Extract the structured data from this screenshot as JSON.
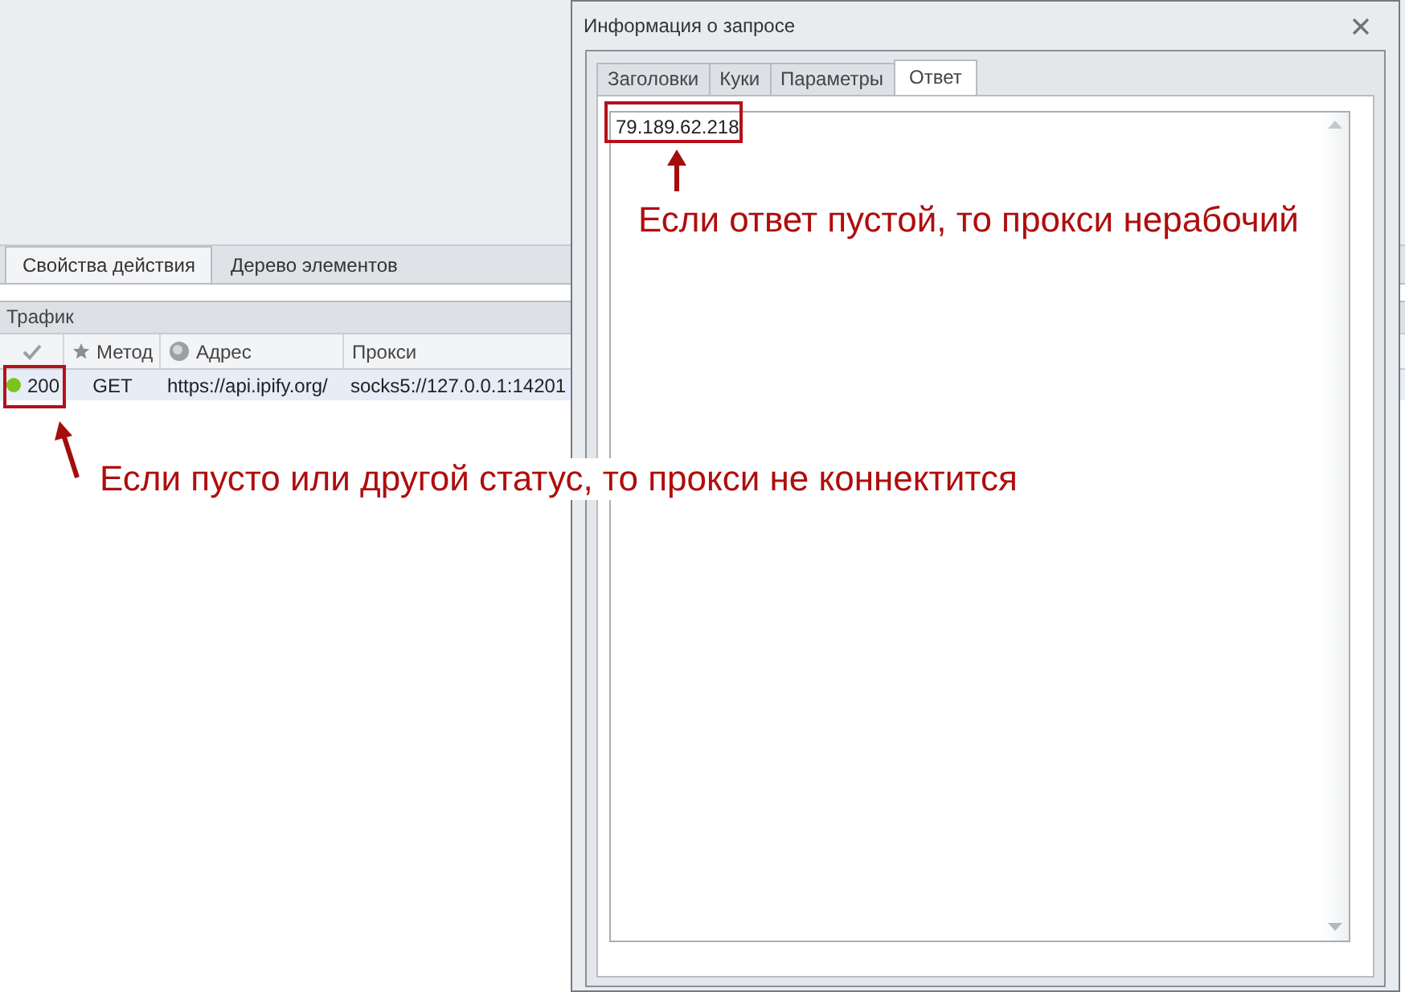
{
  "main_window": {
    "tabs": [
      {
        "label": "Свойства действия",
        "selected": true
      },
      {
        "label": "Дерево элементов",
        "selected": false
      }
    ],
    "traffic_panel": {
      "title": "Трафик",
      "columns": [
        {
          "kind": "check"
        },
        {
          "kind": "star",
          "label": "Метод"
        },
        {
          "kind": "globe",
          "label": "Адрес"
        },
        {
          "kind": "plain",
          "label": "Прокси"
        }
      ],
      "rows": [
        {
          "status": "200",
          "color": "#7cc320",
          "method": "GET",
          "address": "https://api.ipify.org/",
          "proxy": "socks5://127.0.0.1:14201",
          "selected": true
        }
      ]
    }
  },
  "dialog": {
    "title": "Информация о запросе",
    "tabs": [
      {
        "label": "Заголовки",
        "selected": false
      },
      {
        "label": "Куки",
        "selected": false
      },
      {
        "label": "Параметры",
        "selected": false
      },
      {
        "label": "Ответ",
        "selected": true
      }
    ],
    "response": "79.189.62.218"
  },
  "annotations": {
    "response_note": "Если ответ пустой, то прокси нерабочий",
    "status_note": "Если пусто или другой статус, то прокси не коннектится"
  }
}
